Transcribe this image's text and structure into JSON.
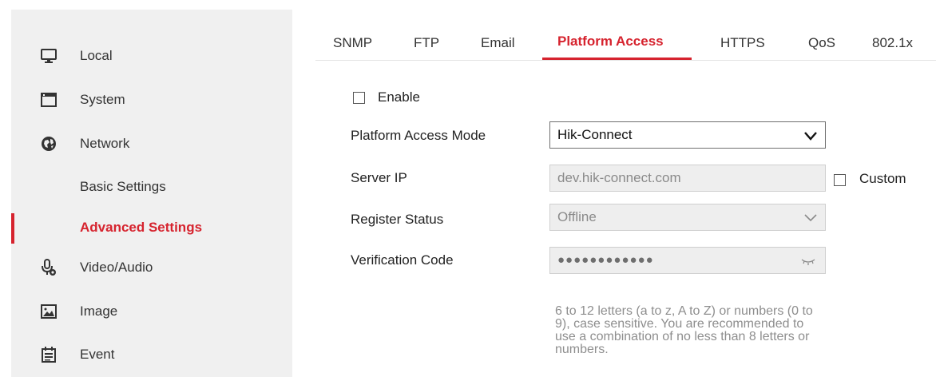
{
  "sidebar": {
    "items": [
      {
        "label": "Local",
        "icon": "monitor-icon"
      },
      {
        "label": "System",
        "icon": "window-icon"
      },
      {
        "label": "Network",
        "icon": "globe-icon"
      },
      {
        "label": "Basic Settings"
      },
      {
        "label": "Advanced Settings",
        "active": true
      },
      {
        "label": "Video/Audio",
        "icon": "microphone-icon"
      },
      {
        "label": "Image",
        "icon": "image-icon"
      },
      {
        "label": "Event",
        "icon": "calendar-icon"
      }
    ]
  },
  "tabs": [
    {
      "label": "SNMP"
    },
    {
      "label": "FTP"
    },
    {
      "label": "Email"
    },
    {
      "label": "Platform Access",
      "active": true
    },
    {
      "label": "HTTPS"
    },
    {
      "label": "QoS"
    },
    {
      "label": "802.1x"
    }
  ],
  "form": {
    "enable_label": "Enable",
    "enable_checked": false,
    "mode_label": "Platform Access Mode",
    "mode_value": "Hik-Connect",
    "server_ip_label": "Server IP",
    "server_ip_value": "dev.hik-connect.com",
    "custom_label": "Custom",
    "custom_checked": false,
    "register_label": "Register Status",
    "register_value": "Offline",
    "code_label": "Verification Code",
    "code_value": "●●●●●●●●●●●●",
    "hint": "6 to 12 letters (a to z, A to Z) or numbers (0 to 9), case sensitive. You are recommended to use a combination of no less than 8 letters or numbers."
  },
  "colors": {
    "accent": "#d6232e",
    "sidebar_bg": "#f0f0f0"
  }
}
